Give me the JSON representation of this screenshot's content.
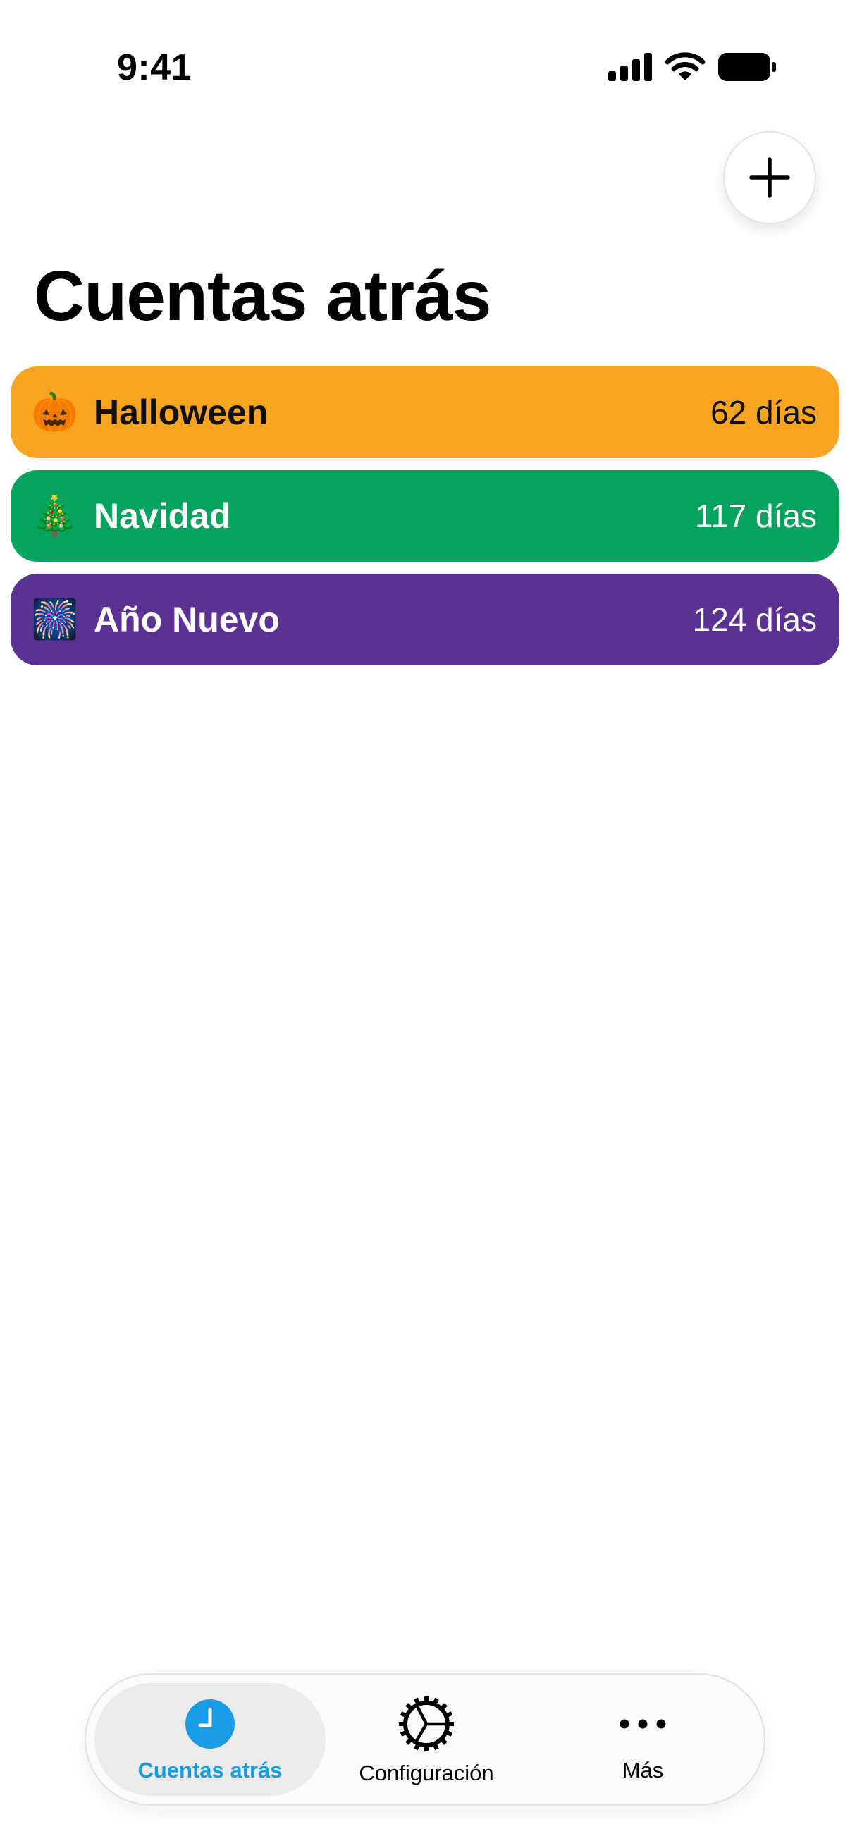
{
  "status_bar": {
    "time": "9:41"
  },
  "header": {
    "title": "Cuentas atrás",
    "add_icon": "plus-icon"
  },
  "countdowns": [
    {
      "emoji": "🎃",
      "name": "Halloween",
      "days": "62 días",
      "bg": "#F7A520",
      "fg": "#111111"
    },
    {
      "emoji": "🎄",
      "name": "Navidad",
      "days": "117 días",
      "bg": "#05A35E",
      "fg": "#ffffff"
    },
    {
      "emoji": "🎆",
      "name": "Año Nuevo",
      "days": "124 días",
      "bg": "#5B3193",
      "fg": "#ffffff"
    }
  ],
  "tab_bar": {
    "tabs": [
      {
        "label": "Cuentas atrás",
        "icon": "clock-icon",
        "selected": true
      },
      {
        "label": "Configuración",
        "icon": "gear-icon",
        "selected": false
      },
      {
        "label": "Más",
        "icon": "more-icon",
        "selected": false
      }
    ],
    "accent": "#1A9BE6"
  }
}
